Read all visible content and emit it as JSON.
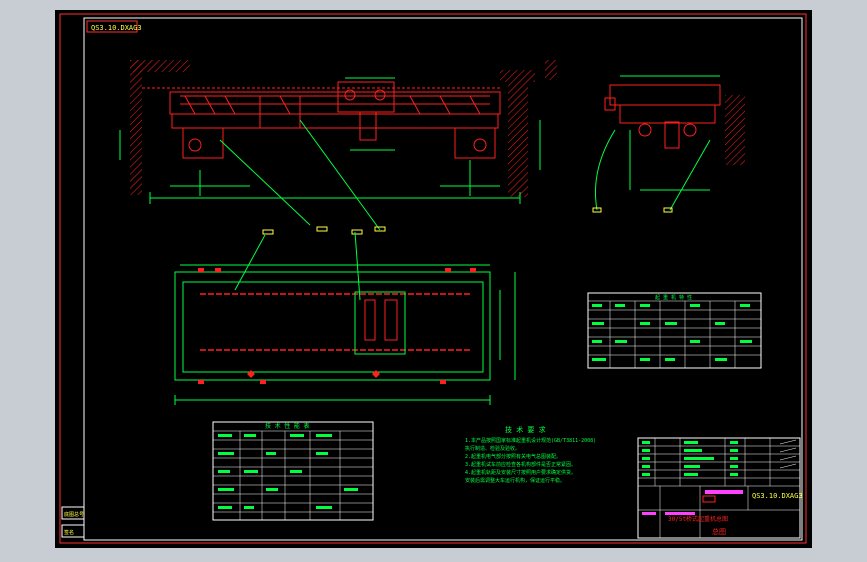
{
  "drawing": {
    "code_top": "QS3.10.DXAG3",
    "code_title": "QS3.10.DXAG3",
    "title_red": "30/5t桥式起重机总图",
    "bottom_label": "总图",
    "margin_labels": [
      "底图总号",
      "签名"
    ],
    "parts_table_header": "技 术 性 能 表",
    "tech_table_header": "起 重 机 特 性",
    "tech_notes_title": "技 术 要 求",
    "tech_notes": [
      "1.本产品按照国家标准起重机设计规范(GB/T3811-2008)",
      "  执行制造、检验及验收。",
      "2.起重机电气部分按照有关电气总图装配。",
      "3.起重机试车前应检查各机构部件是否正常紧固。",
      "4.起重机轨距及安装尺寸按照用户要求确定供货。",
      "  安装后需调整大车运行机构，保证运行平稳。"
    ]
  },
  "colors": {
    "frame": "#ff3030",
    "line": "#00ff40",
    "red": "#ff2020",
    "white": "#ffffff",
    "magenta": "#ff40ff",
    "yellow": "#ffff40",
    "bg": "#000000"
  }
}
